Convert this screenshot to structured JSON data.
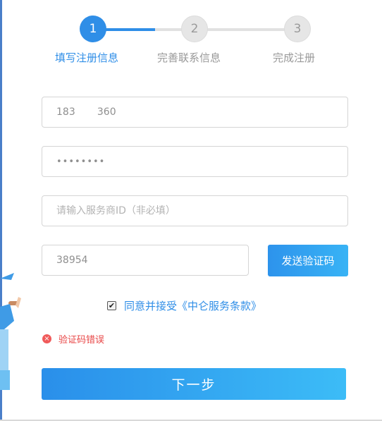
{
  "steps": [
    {
      "number": "1",
      "label": "填写注册信息",
      "state": "active"
    },
    {
      "number": "2",
      "label": "完善联系信息",
      "state": "inactive"
    },
    {
      "number": "3",
      "label": "完成注册",
      "state": "inactive"
    }
  ],
  "form": {
    "phone_value": "183       360",
    "password_value": "••••••••",
    "service_id_placeholder": "请输入服务商ID（非必填）",
    "verification_code_value": "38954",
    "send_code_label": "发送验证码"
  },
  "agreement": {
    "checked": true,
    "check_mark": "✔",
    "text": "同意并接受《中仑服务条款》"
  },
  "error": {
    "icon": "×",
    "text": "验证码错误"
  },
  "next_label": "下一步",
  "colors": {
    "accent": "#2f8ee7",
    "error": "#e84545",
    "inactive": "#999999"
  }
}
